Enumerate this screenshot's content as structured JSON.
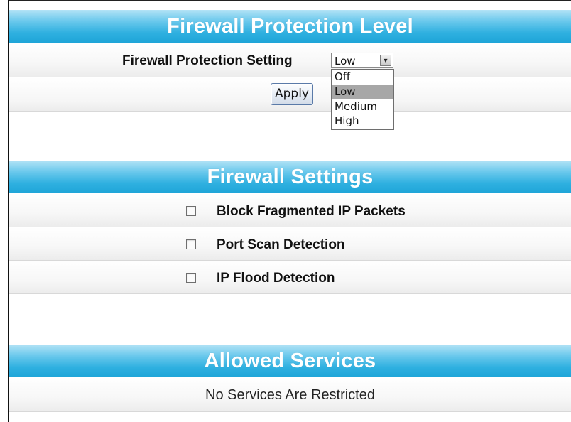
{
  "firewall_protection": {
    "header": "Firewall Protection Level",
    "setting_label": "Firewall Protection Setting",
    "selected_value": "Low",
    "options": [
      "Off",
      "Low",
      "Medium",
      "High"
    ],
    "apply_label": "Apply"
  },
  "firewall_settings": {
    "header": "Firewall Settings",
    "items": [
      {
        "label": "Block Fragmented IP Packets",
        "checked": false
      },
      {
        "label": "Port Scan Detection",
        "checked": false
      },
      {
        "label": "IP Flood Detection",
        "checked": false
      }
    ]
  },
  "allowed_services": {
    "header": "Allowed Services",
    "status": "No Services Are Restricted"
  },
  "colors": {
    "header_gradient_top": "#b3e3f6",
    "header_gradient_bottom": "#1ea5d8",
    "header_text": "#ffffff",
    "selected_option": "#a7a7a7"
  }
}
